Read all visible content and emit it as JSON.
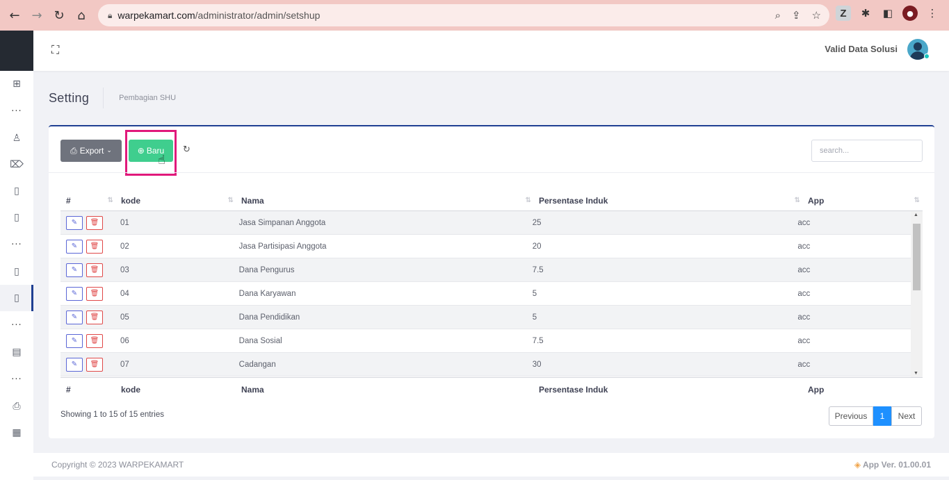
{
  "browser": {
    "url_domain": "warpekamart.com",
    "url_path": "/administrator/admin/setshup"
  },
  "topbar": {
    "user_name": "Valid Data Solusi"
  },
  "page": {
    "title": "Setting",
    "breadcrumb": "Pembagian SHU"
  },
  "toolbar": {
    "export_label": "Export",
    "new_label": "Baru",
    "search_placeholder": "search..."
  },
  "table": {
    "columns": [
      "#",
      "kode",
      "Nama",
      "Persentase Induk",
      "App"
    ],
    "rows": [
      {
        "kode": "01",
        "nama": "Jasa Simpanan Anggota",
        "persen": "25",
        "app": "acc"
      },
      {
        "kode": "02",
        "nama": "Jasa Partisipasi Anggota",
        "persen": "20",
        "app": "acc"
      },
      {
        "kode": "03",
        "nama": "Dana Pengurus",
        "persen": "7.5",
        "app": "acc"
      },
      {
        "kode": "04",
        "nama": "Dana Karyawan",
        "persen": "5",
        "app": "acc"
      },
      {
        "kode": "05",
        "nama": "Dana Pendidikan",
        "persen": "5",
        "app": "acc"
      },
      {
        "kode": "06",
        "nama": "Dana Sosial",
        "persen": "7.5",
        "app": "acc"
      },
      {
        "kode": "07",
        "nama": "Cadangan",
        "persen": "30",
        "app": "acc"
      }
    ],
    "info": "Showing 1 to 15 of 15 entries"
  },
  "pagination": {
    "previous": "Previous",
    "current": "1",
    "next": "Next"
  },
  "footer": {
    "copyright": "Copyright © 2023 WARPEKAMART",
    "version": "App Ver. 01.00.01"
  },
  "colors": {
    "accent": "#1f3f92",
    "success_button": "#3fce8e",
    "highlight": "#e0197b",
    "page_active": "#1e90ff"
  }
}
